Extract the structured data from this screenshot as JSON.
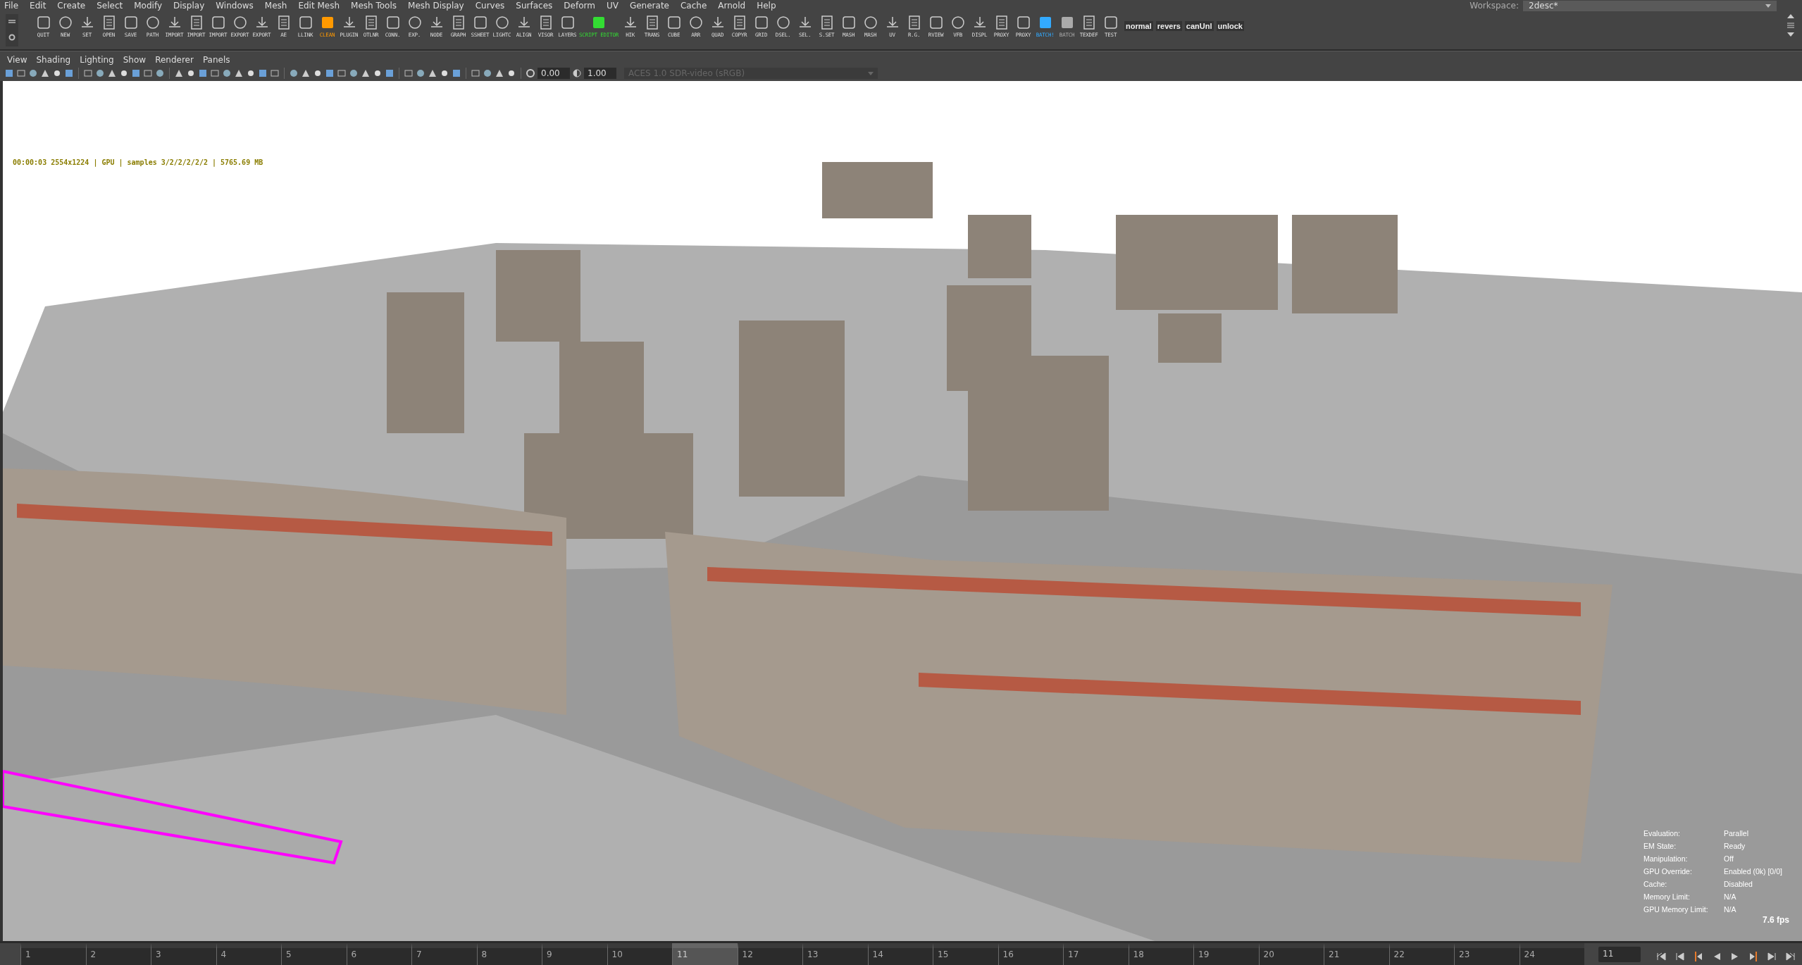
{
  "menu_bar": {
    "items": [
      "File",
      "Edit",
      "Create",
      "Select",
      "Modify",
      "Display",
      "Windows",
      "Mesh",
      "Edit Mesh",
      "Mesh Tools",
      "Mesh Display",
      "Curves",
      "Surfaces",
      "Deform",
      "UV",
      "Generate",
      "Cache",
      "Arnold",
      "Help"
    ],
    "workspace_label": "Workspace:",
    "workspace_value": "2desc*"
  },
  "shelf": {
    "items": [
      {
        "label": "QUIT",
        "kind": "icon"
      },
      {
        "label": "NEW",
        "kind": "icon"
      },
      {
        "label": "SET",
        "kind": "icon"
      },
      {
        "label": "OPEN",
        "kind": "icon"
      },
      {
        "label": "SAVE",
        "kind": "icon"
      },
      {
        "label": "PATH",
        "kind": "icon"
      },
      {
        "label": "IMPORT",
        "kind": "icon"
      },
      {
        "label": "IMPORT",
        "kind": "icon"
      },
      {
        "label": "IMPORT",
        "kind": "icon"
      },
      {
        "label": "EXPORT",
        "kind": "icon"
      },
      {
        "label": "EXPORT",
        "kind": "icon"
      },
      {
        "label": "AE",
        "kind": "icon"
      },
      {
        "label": "LLINK",
        "kind": "icon"
      },
      {
        "label": "CLEAN",
        "kind": "icon",
        "color": "#ff9900"
      },
      {
        "label": "PLUGIN",
        "kind": "icon"
      },
      {
        "label": "OTLNR",
        "kind": "icon"
      },
      {
        "label": "CONN.",
        "kind": "icon"
      },
      {
        "label": "EXP.",
        "kind": "icon"
      },
      {
        "label": "NODE",
        "kind": "icon"
      },
      {
        "label": "GRAPH",
        "kind": "icon"
      },
      {
        "label": "SSHEET",
        "kind": "icon"
      },
      {
        "label": "LIGHTC",
        "kind": "icon"
      },
      {
        "label": "ALIGN",
        "kind": "icon"
      },
      {
        "label": "VISOR",
        "kind": "icon"
      },
      {
        "label": "LAYERS",
        "kind": "icon"
      },
      {
        "label": "SCRIPT EDITOR",
        "kind": "icon",
        "color": "#33dd33"
      },
      {
        "label": "HIK",
        "kind": "icon"
      },
      {
        "label": "TRANS",
        "kind": "icon"
      },
      {
        "label": "CUBE",
        "kind": "icon"
      },
      {
        "label": "ARR",
        "kind": "icon"
      },
      {
        "label": "QUAD",
        "kind": "icon"
      },
      {
        "label": "COPYR",
        "kind": "icon"
      },
      {
        "label": "GRID",
        "kind": "icon"
      },
      {
        "label": "DSEL.",
        "kind": "icon"
      },
      {
        "label": "SEL.",
        "kind": "icon"
      },
      {
        "label": "S.SET",
        "kind": "icon"
      },
      {
        "label": "MASH",
        "kind": "icon"
      },
      {
        "label": "MASH",
        "kind": "icon"
      },
      {
        "label": "UV",
        "kind": "icon"
      },
      {
        "label": "R.G.",
        "kind": "icon"
      },
      {
        "label": "RVIEW",
        "kind": "icon"
      },
      {
        "label": "VFB",
        "kind": "icon"
      },
      {
        "label": "DISPL",
        "kind": "icon"
      },
      {
        "label": "PROXY",
        "kind": "icon"
      },
      {
        "label": "PROXY",
        "kind": "icon"
      },
      {
        "label": "BATCH!",
        "kind": "icon",
        "color": "#33aaff"
      },
      {
        "label": "BATCH",
        "kind": "icon",
        "color": "#aaaaaa"
      },
      {
        "label": "TEXDEF",
        "kind": "icon"
      },
      {
        "label": "TEST",
        "kind": "icon"
      },
      {
        "label": "normal",
        "kind": "text"
      },
      {
        "label": "revers",
        "kind": "text"
      },
      {
        "label": "canUnl",
        "kind": "text"
      },
      {
        "label": "unlock",
        "kind": "text"
      }
    ]
  },
  "panel_menu": [
    "View",
    "Shading",
    "Lighting",
    "Show",
    "Renderer",
    "Panels"
  ],
  "panel_toolbar": {
    "exposure": "0.00",
    "gamma": "1.00",
    "color_space": "ACES 1.0 SDR-video (sRGB)"
  },
  "viewport": {
    "render_info": "00:00:03 2554x1224 | GPU | samples 3/2/2/2/2/2 | 5765.69 MB",
    "hud": [
      {
        "label": "Evaluation:",
        "value": "Parallel"
      },
      {
        "label": "EM State:",
        "value": "Ready"
      },
      {
        "label": "Manipulation:",
        "value": "Off"
      },
      {
        "label": "GPU Override:",
        "value": "Enabled (0k) [0/0]"
      },
      {
        "label": "Cache:",
        "value": "Disabled"
      },
      {
        "label": "Memory Limit:",
        "value": "N/A"
      },
      {
        "label": "GPU Memory Limit:",
        "value": "N/A"
      }
    ],
    "fps": "7.6 fps"
  },
  "timeline": {
    "frames": [
      {
        "label": "1",
        "selected": false
      },
      {
        "label": "2",
        "selected": false
      },
      {
        "label": "3",
        "selected": false
      },
      {
        "label": "4",
        "selected": false
      },
      {
        "label": "5",
        "selected": false
      },
      {
        "label": "6",
        "selected": false
      },
      {
        "label": "7",
        "selected": false
      },
      {
        "label": "8",
        "selected": false
      },
      {
        "label": "9",
        "selected": false
      },
      {
        "label": "10",
        "selected": false
      },
      {
        "label": "11",
        "selected": true
      },
      {
        "label": "12",
        "selected": false
      },
      {
        "label": "13",
        "selected": false
      },
      {
        "label": "14",
        "selected": false
      },
      {
        "label": "15",
        "selected": false
      },
      {
        "label": "16",
        "selected": false
      },
      {
        "label": "17",
        "selected": false
      },
      {
        "label": "18",
        "selected": false
      },
      {
        "label": "19",
        "selected": false
      },
      {
        "label": "20",
        "selected": false
      },
      {
        "label": "21",
        "selected": false
      },
      {
        "label": "22",
        "selected": false
      },
      {
        "label": "23",
        "selected": false
      },
      {
        "label": "24",
        "selected": false
      }
    ],
    "current_frame": "11"
  }
}
